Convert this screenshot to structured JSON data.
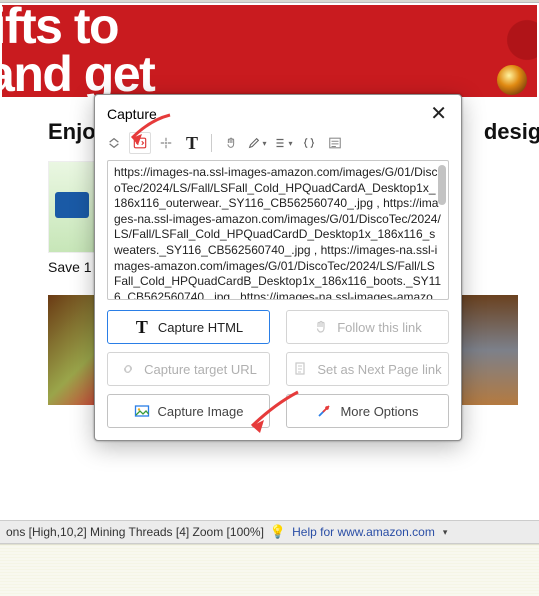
{
  "banner": {
    "line1": "h gifts to",
    "line2": "ve and get"
  },
  "headline_left": "Enjo",
  "headline_right": "designe",
  "caption_left": "Save 1",
  "capture": {
    "title": "Capture",
    "textarea": "https://images-na.ssl-images-amazon.com/images/G/01/DiscoTec/2024/LS/Fall/LSFall_Cold_HPQuadCardA_Desktop1x_186x116_outerwear._SY116_CB562560740_.jpg , https://images-na.ssl-images-amazon.com/images/G/01/DiscoTec/2024/LS/Fall/LSFall_Cold_HPQuadCardD_Desktop1x_186x116_sweaters._SY116_CB562560740_.jpg , https://images-na.ssl-images-amazon.com/images/G/01/DiscoTec/2024/LS/Fall/LSFall_Cold_HPQuadCardB_Desktop1x_186x116_boots._SY116_CB562560740_.jpg , https://images-na.ssl-images-amazon.com/images/G/01/DiscoTec/2024/LS/Fall/LSFall_Cold_H",
    "btn_capture_html": "Capture HTML",
    "btn_follow_link": "Follow this link",
    "btn_capture_url": "Capture target URL",
    "btn_next_page": "Set as Next Page link",
    "btn_capture_image": "Capture Image",
    "btn_more_options": "More Options"
  },
  "status": {
    "left": "ons [High,10,2] Mining Threads [4] Zoom [100%]",
    "help": "Help for www.amazon.com"
  }
}
